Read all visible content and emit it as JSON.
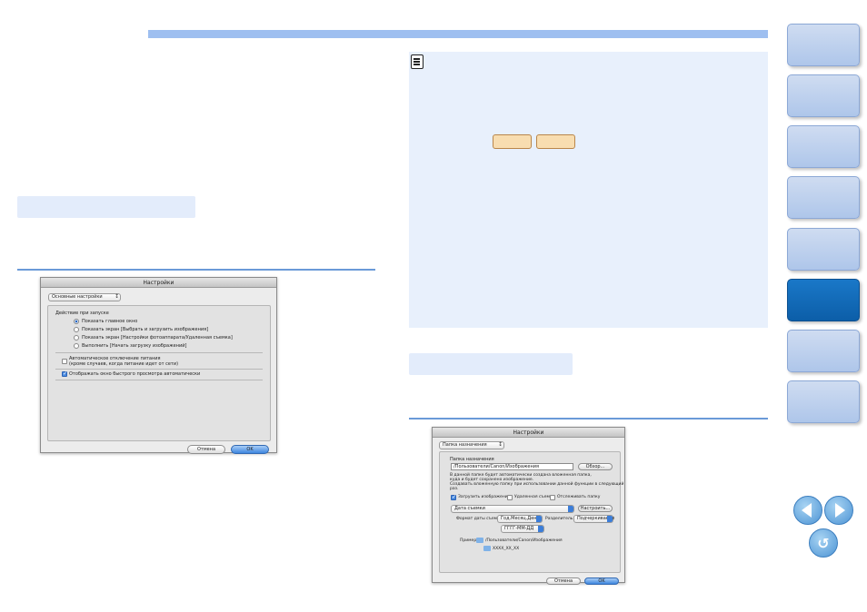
{
  "colors": {
    "accent_bar": "#9ebff0",
    "section_head": "#e3ecfb",
    "note_bg": "#e8f0fc",
    "active_tab": "#1a78c8",
    "tab": "#aec6ea",
    "key_button": "#f8ddb0"
  },
  "icons": {
    "note": "memo-icon",
    "prev": "arrow-left-icon",
    "next": "arrow-right-icon",
    "back": "return-icon"
  },
  "sidetabs": [
    {
      "label": ""
    },
    {
      "label": ""
    },
    {
      "label": ""
    },
    {
      "label": ""
    },
    {
      "label": ""
    },
    {
      "label": "",
      "active": true
    },
    {
      "label": ""
    },
    {
      "label": ""
    }
  ],
  "dialog1": {
    "title": "Настройки",
    "popup": "Основные настройки",
    "startup_label": "Действие при запуске",
    "radios": [
      {
        "label": "Показать главное окно",
        "selected": true
      },
      {
        "label": "Показать экран [Выбрать и загрузить изображения]",
        "selected": false
      },
      {
        "label": "Показать экран [Настройки фотоаппарата/Удаленная съемка]",
        "selected": false
      },
      {
        "label": "Выполнить [Начать загрузку изображений]",
        "selected": false
      }
    ],
    "auto_power_line1": "Автоматическое отключение питания",
    "auto_power_line2": "(кроме случаев, когда питание идет от сети)",
    "auto_power_checked": false,
    "quick_preview": "Отображать окно быстрого просмотра автоматически",
    "quick_preview_checked": true,
    "cancel": "Отмена",
    "ok": "OK"
  },
  "dialog2": {
    "title": "Настройки",
    "popup": "Папка назначения",
    "dest_label": "Папка назначения",
    "dest_path": "/Пользователи/Canon/Изображения",
    "browse": "Обзор...",
    "info1": "В данной папке будет автоматически создана вложенная папка,",
    "info2": "куда и будет сохранено изображение.",
    "info3": "Создавать вложенную папку при использовании данной функции в следующий",
    "info4": "раз.",
    "check_load": "Загрузить изображения",
    "check_remote": "Удаленная съемка",
    "check_monitor": "Отслеживать папку",
    "subfolder_popup": "Дата съемки",
    "customize": "Настроить...",
    "date_format_label": "Формат даты съемки:",
    "date_format": "Год.Месяц.День",
    "separator_label": "Разделитель:",
    "separator": "Подчеркивание",
    "format_value": "ГГГГ-ММ-ДД",
    "example_label": "Пример:",
    "example_path": "/Пользователи/Canon/Изображения",
    "example_sub": "XXXX_XX_XX",
    "cancel": "Отмена",
    "ok": "OK"
  }
}
